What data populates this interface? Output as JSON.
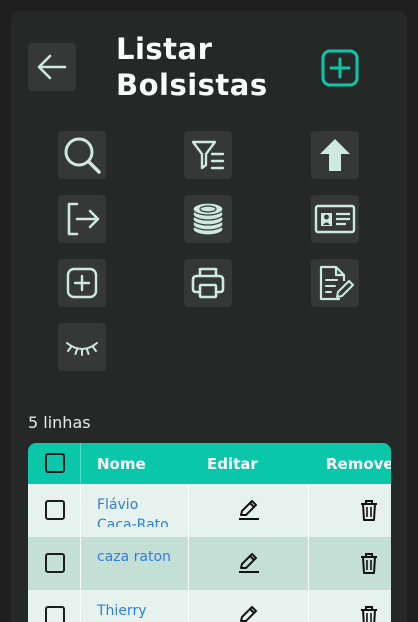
{
  "header": {
    "title_line1": "Listar",
    "title_line2": "Bolsistas",
    "back_icon": "arrow-left-icon",
    "add_icon": "plus-square-icon"
  },
  "toolbar": [
    {
      "icon": "search-icon"
    },
    {
      "icon": "filter-list-icon"
    },
    {
      "icon": "arrow-up-icon"
    },
    {
      "icon": "logout-icon"
    },
    {
      "icon": "coins-icon"
    },
    {
      "icon": "id-card-icon"
    },
    {
      "icon": "plus-square-icon"
    },
    {
      "icon": "printer-icon"
    },
    {
      "icon": "document-edit-icon"
    },
    {
      "icon": "eye-closed-icon"
    }
  ],
  "table": {
    "count_label": "5 linhas",
    "headers": [
      "Nome",
      "Editar",
      "Remover"
    ],
    "rows": [
      {
        "name": "Flávio Caca-Rato"
      },
      {
        "name": "caza raton"
      },
      {
        "name": "Thierry"
      }
    ]
  },
  "colors": {
    "accent": "#0ac7aa",
    "background": "#1e1f1e",
    "panel": "#262827",
    "icon_fg": "#cde9e0",
    "row_odd": "#e6f2ee",
    "row_even": "#c4dfd6",
    "link": "#2f7fe0"
  }
}
